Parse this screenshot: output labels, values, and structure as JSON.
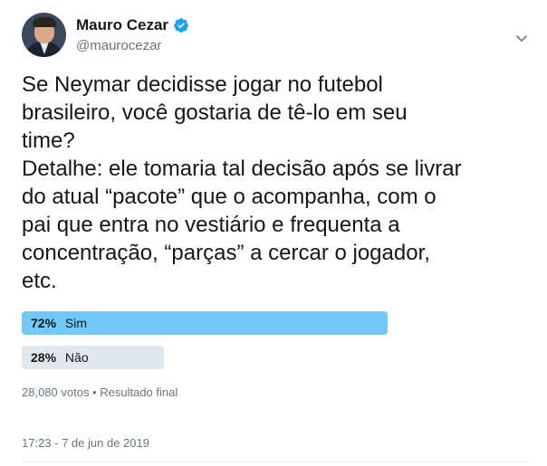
{
  "author": {
    "name": "Mauro Cezar",
    "handle": "@maurocezar",
    "verified": true
  },
  "tweet": {
    "text": "Se Neymar decidisse jogar no futebol\nbrasileiro, você gostaria de tê-lo em seu\ntime?\nDetalhe: ele tomaria tal decisão após se livrar\ndo atual “pacote” que o acompanha, com o\npai que entra no vestiário e frequenta a\nconcentração, “parças” a cercar o jogador,\netc."
  },
  "poll": {
    "options": [
      {
        "percent": "72%",
        "label": "Sim",
        "fraction": 0.72,
        "winner": true
      },
      {
        "percent": "28%",
        "label": "Não",
        "fraction": 0.28,
        "winner": false
      }
    ],
    "meta": "28,080 votos • Resultado final"
  },
  "timestamp": "17:23 - 7 de jun de 2019",
  "icons": {
    "verified": "verified-badge-icon",
    "menu": "chevron-down-icon"
  },
  "colors": {
    "winner_bar": "#71c9f8",
    "other_bar": "#e1e8ed",
    "verified": "#1da1f2"
  }
}
